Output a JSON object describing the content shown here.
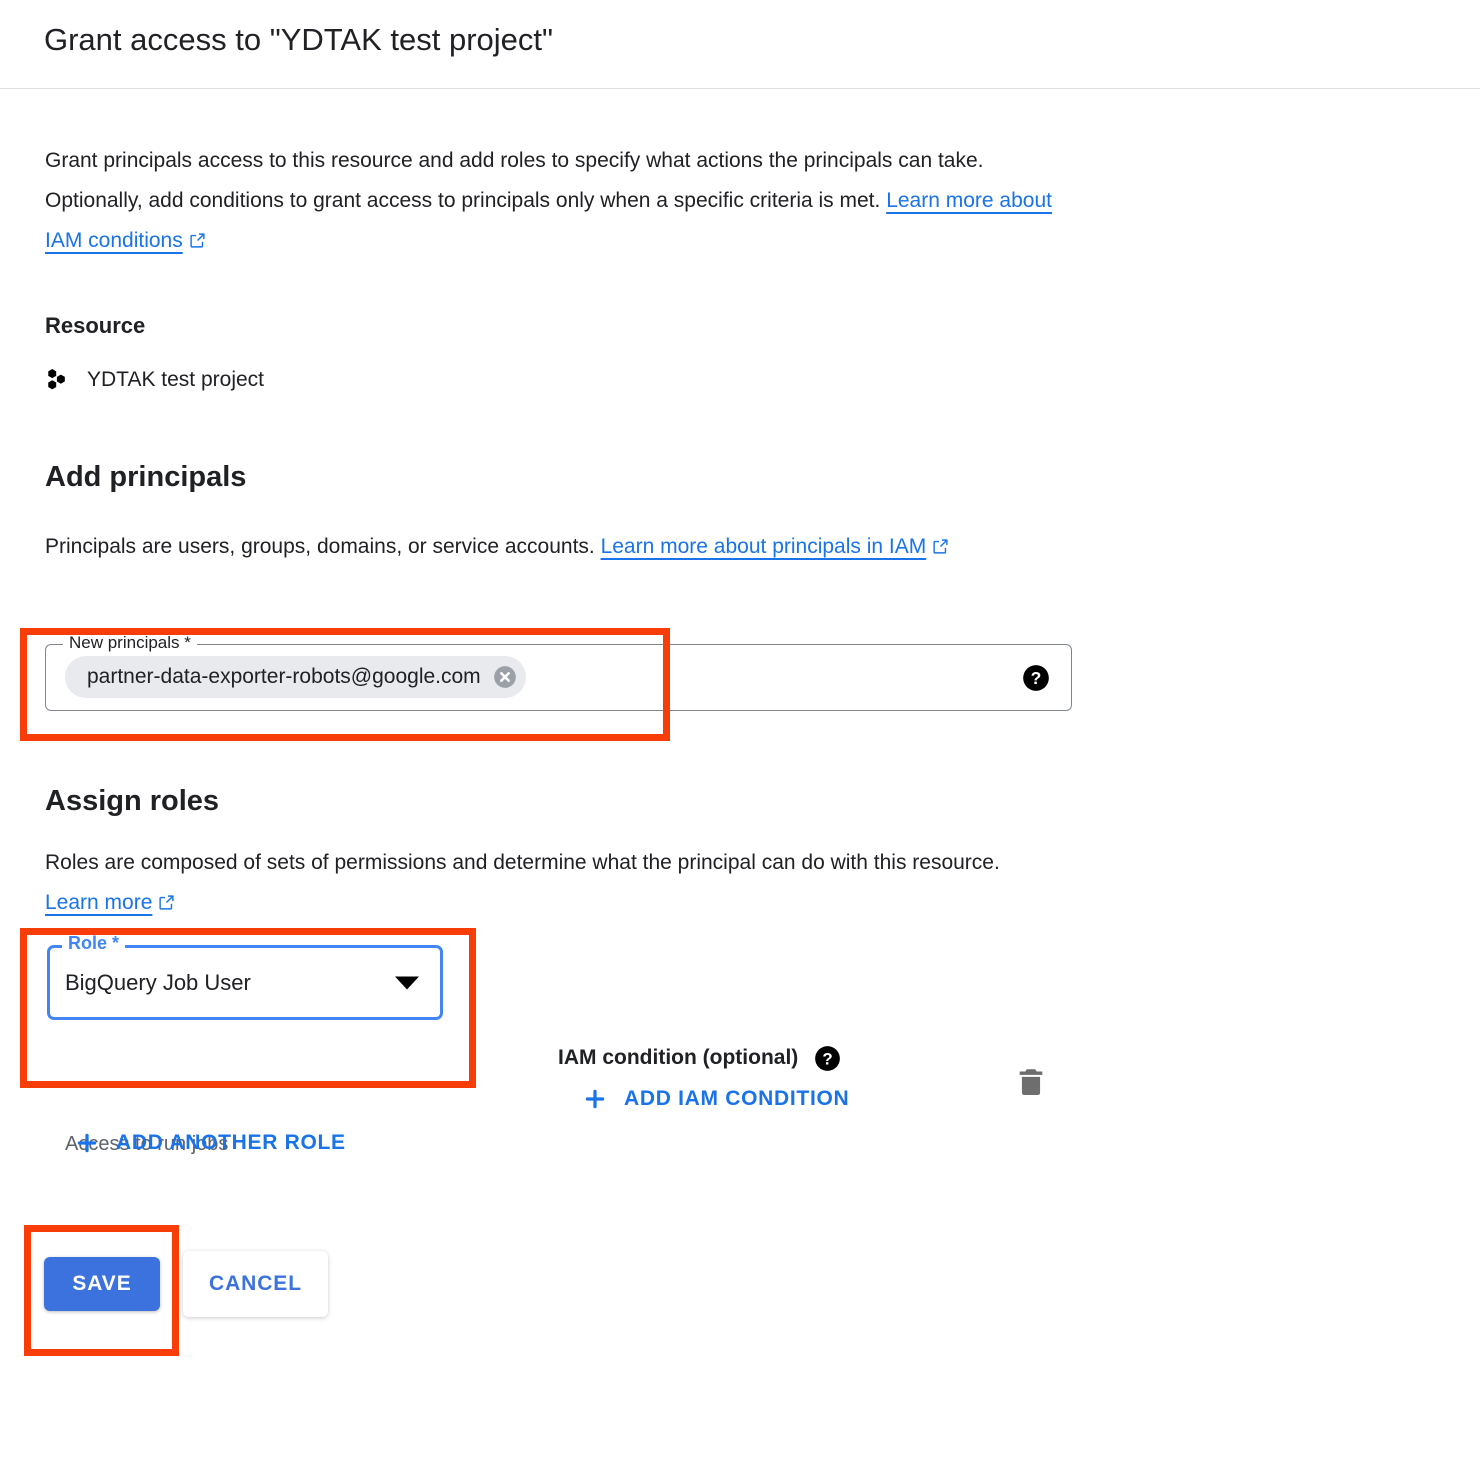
{
  "dialog": {
    "title": "Grant access to \"YDTAK test project\"",
    "intro": {
      "text_part1": "Grant principals access to this resource and add roles to specify what actions the principals can take. Optionally, add conditions to grant access to principals only when a specific criteria is met. ",
      "link_label": "Learn more about IAM conditions",
      "link_icon": "open-in-new-icon"
    }
  },
  "resource": {
    "heading": "Resource",
    "icon": "cloud-project-icon",
    "name": "YDTAK test project"
  },
  "add_principals": {
    "heading": "Add principals",
    "description_part1": "Principals are users, groups, domains, or service accounts. ",
    "link_label": "Learn more about principals in IAM",
    "link_icon": "open-in-new-icon",
    "field": {
      "label": "New principals *",
      "chips": [
        {
          "label": "partner-data-exporter-robots@google.com",
          "remove_icon": "cancel-circle-icon"
        }
      ],
      "help_icon": "help-filled-icon",
      "placeholder": ""
    }
  },
  "assign_roles": {
    "heading": "Assign roles",
    "description_part1": "Roles are composed of sets of permissions and determine what the principal can do with this resource. ",
    "link_label": "Learn more",
    "link_icon": "open-in-new-icon",
    "role_row": {
      "select_label": "Role *",
      "select_value": "BigQuery Job User",
      "caret_icon": "arrow-drop-down-icon",
      "hint": "Access to run jobs",
      "iam_condition_label": "IAM condition (optional)",
      "iam_condition_help_icon": "help-filled-icon",
      "add_iam_condition_label": "ADD IAM CONDITION",
      "add_icon": "plus-icon",
      "delete_icon": "trash-icon"
    },
    "add_another_role_label": "ADD ANOTHER ROLE",
    "add_another_role_icon": "plus-icon"
  },
  "footer": {
    "save_label": "SAVE",
    "cancel_label": "CANCEL"
  },
  "annotations": {
    "color": "#f93d08",
    "boxes": [
      {
        "name": "new-principals-field"
      },
      {
        "name": "role-select"
      },
      {
        "name": "save-button"
      }
    ]
  },
  "colors": {
    "accent_blue": "#1a73e8",
    "focus_blue": "#4285f4",
    "save_blue": "#3c72dd",
    "annotation_red": "#f93d08",
    "text_primary": "#202124",
    "text_secondary": "#5f6368",
    "chip_bg": "#e8eaed",
    "divider": "#e0e0e0"
  }
}
